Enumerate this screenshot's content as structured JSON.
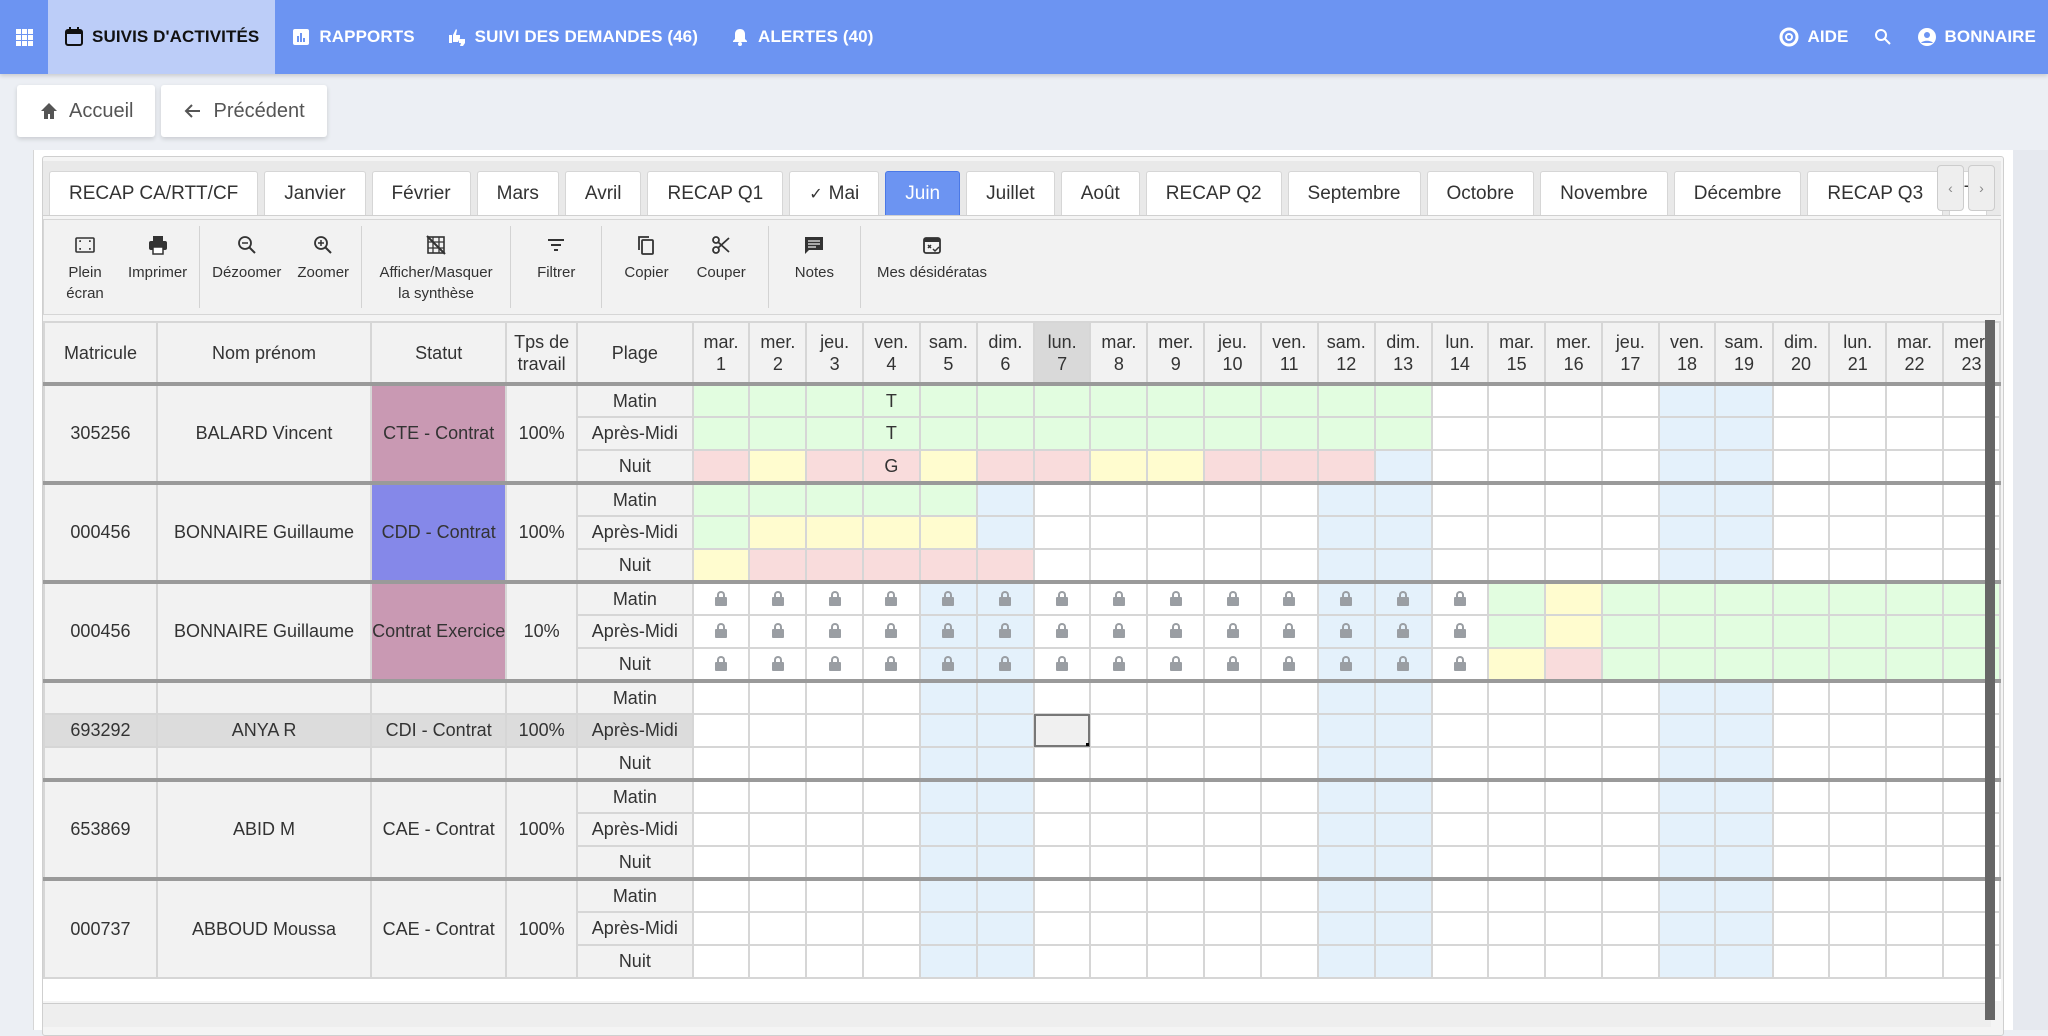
{
  "topnav": {
    "items": [
      {
        "icon": "calendar-icon",
        "label": "SUIVIS D'ACTIVITÉS",
        "active": true
      },
      {
        "icon": "chart-icon",
        "label": "RAPPORTS",
        "active": false
      },
      {
        "icon": "thumbs-icon",
        "label": "SUIVI DES DEMANDES (46)",
        "active": false
      },
      {
        "icon": "bell-icon",
        "label": "ALERTES (40)",
        "active": false
      }
    ],
    "help_label": "AIDE",
    "user_label": "BONNAIRE"
  },
  "crumbs": {
    "home_label": "Accueil",
    "back_label": "Précédent"
  },
  "tabs": [
    {
      "label": "RECAP CA/RTT/CF"
    },
    {
      "label": "Janvier"
    },
    {
      "label": "Février"
    },
    {
      "label": "Mars"
    },
    {
      "label": "Avril"
    },
    {
      "label": "RECAP Q1"
    },
    {
      "label": "Mai",
      "checked": true
    },
    {
      "label": "Juin",
      "active": true
    },
    {
      "label": "Juillet"
    },
    {
      "label": "Août"
    },
    {
      "label": "RECAP Q2"
    },
    {
      "label": "Septembre"
    },
    {
      "label": "Octobre"
    },
    {
      "label": "Novembre"
    },
    {
      "label": "Décembre"
    },
    {
      "label": "RECAP Q3"
    },
    {
      "label": "T"
    }
  ],
  "tab_arrows": {
    "prev": "‹",
    "next": "›"
  },
  "toolbar": {
    "fullscreen": "Plein écran",
    "print": "Imprimer",
    "zoom_out": "Dézoomer",
    "zoom_in": "Zoomer",
    "toggle_summary": "Afficher/Masquer la synthèse",
    "filter": "Filtrer",
    "copy": "Copier",
    "cut": "Couper",
    "notes": "Notes",
    "wishes": "Mes désidératas"
  },
  "grid": {
    "headers": {
      "matricule": "Matricule",
      "name": "Nom prénom",
      "statut": "Statut",
      "tps": "Tps de travail",
      "plage": "Plage"
    },
    "days": [
      {
        "d": "mar.",
        "n": "1"
      },
      {
        "d": "mer.",
        "n": "2"
      },
      {
        "d": "jeu.",
        "n": "3"
      },
      {
        "d": "ven.",
        "n": "4"
      },
      {
        "d": "sam.",
        "n": "5"
      },
      {
        "d": "dim.",
        "n": "6"
      },
      {
        "d": "lun.",
        "n": "7",
        "today": true
      },
      {
        "d": "mar.",
        "n": "8"
      },
      {
        "d": "mer.",
        "n": "9"
      },
      {
        "d": "jeu.",
        "n": "10"
      },
      {
        "d": "ven.",
        "n": "11"
      },
      {
        "d": "sam.",
        "n": "12"
      },
      {
        "d": "dim.",
        "n": "13"
      },
      {
        "d": "lun.",
        "n": "14"
      },
      {
        "d": "mar.",
        "n": "15"
      },
      {
        "d": "mer.",
        "n": "16"
      },
      {
        "d": "jeu.",
        "n": "17"
      },
      {
        "d": "ven.",
        "n": "18"
      },
      {
        "d": "sam.",
        "n": "19"
      },
      {
        "d": "dim.",
        "n": "20"
      },
      {
        "d": "lun.",
        "n": "21"
      },
      {
        "d": "mar.",
        "n": "22"
      },
      {
        "d": "mer.",
        "n": "23"
      }
    ],
    "plages": [
      "Matin",
      "Après-Midi",
      "Nuit"
    ],
    "legend_colors": {
      "g": "#e2fde0",
      "y": "#fffccf",
      "r": "#f9dcdc",
      "b": "#e4f1fb",
      "w": "#ffffff"
    },
    "employees": [
      {
        "matricule": "305256",
        "name": "BALARD Vincent",
        "statut": "CTE - Contrat",
        "statut_color": "#c999b3",
        "tps": "100%",
        "rows": [
          {
            "cells": "gggggggggggggwwwwbbwwww",
            "marks": {
              "3": "T"
            }
          },
          {
            "cells": "gggggggggggggwwwwbbwwww",
            "marks": {
              "3": "T"
            }
          },
          {
            "cells": "ryrryrryyrrrbwwwwbbwwww",
            "marks": {
              "3": "G"
            }
          }
        ]
      },
      {
        "matricule": "000456",
        "name": "BONNAIRE Guillaume",
        "statut": "CDD - Contrat",
        "statut_color": "#8588e9",
        "tps": "100%",
        "rows": [
          {
            "cells": "gggggbwwwwwbbwwwwbbwwww"
          },
          {
            "cells": "gyyyybwwwwwbbwwwwbbwwww"
          },
          {
            "cells": "yrrrrrwwwwwbbwwwwbbwwww"
          }
        ]
      },
      {
        "matricule": "000456",
        "name": "BONNAIRE Guillaume",
        "statut": "Contrat Exercice",
        "statut_color": "#c999b3",
        "tps": "10%",
        "rows": [
          {
            "cells": "wwwwbbwwwwwbbwgyggggggg",
            "locked_until": 14
          },
          {
            "cells": "wwwwbbwwwwwbbwgyggggggg",
            "locked_until": 14
          },
          {
            "cells": "wwwwbbwwwwwbbwyrggggggg",
            "locked_until": 14
          }
        ]
      },
      {
        "matricule": "693292",
        "name": "ANYA R",
        "statut": "CDI - Contrat",
        "statut_color": "",
        "tps": "100%",
        "selected": true,
        "rows": [
          {
            "cells": "wwwwbbwwwwwbbwwwwbbwwww"
          },
          {
            "cells": "wwwwbbswwwwbbwwwwbbwwww"
          },
          {
            "cells": "wwwwbbwwwwwbbwwwwbbwwww"
          }
        ]
      },
      {
        "matricule": "653869",
        "name": "ABID M",
        "statut": "CAE - Contrat",
        "statut_color": "",
        "tps": "100%",
        "rows": [
          {
            "cells": "wwwwbbwwwwwbbwwwwbbwwww"
          },
          {
            "cells": "wwwwbbwwwwwbbwwwwbbwwww"
          },
          {
            "cells": "wwwwbbwwwwwbbwwwwbbwwww"
          }
        ]
      },
      {
        "matricule": "000737",
        "name": "ABBOUD Moussa",
        "statut": "CAE - Contrat",
        "statut_color": "",
        "tps": "100%",
        "rows": [
          {
            "cells": "wwwwbbwwwwwbbwwwwbbwwww"
          },
          {
            "cells": "wwwwbbwwwwwbbwwwwbbwwww"
          },
          {
            "cells": "wwwwbbwwwwwbbwwwwbbwwww"
          }
        ]
      }
    ]
  }
}
